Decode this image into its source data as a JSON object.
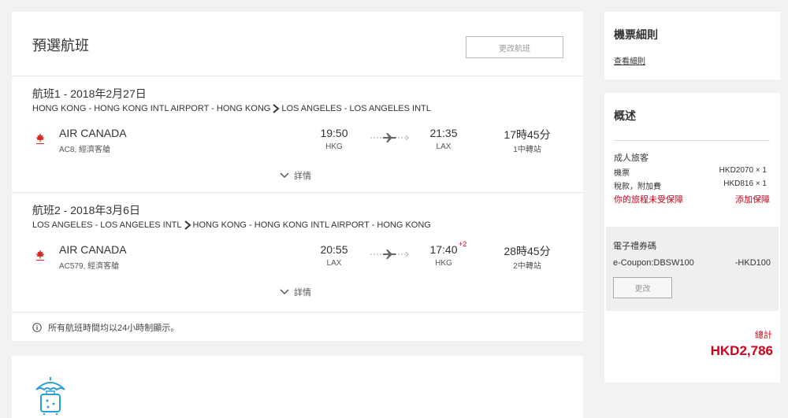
{
  "header": {
    "title": "預選航班",
    "change_button": "更改航班"
  },
  "segments": [
    {
      "title": "航班1 - 2018年2月27日",
      "origin": "HONG KONG - HONG KONG INTL AIRPORT - HONG KONG",
      "destination": "LOS ANGELES - LOS ANGELES INTL",
      "airline": "AIR CANADA",
      "flight": "AC8, 經濟客艙",
      "dep_time": "19:50",
      "dep_code": "HKG",
      "arr_time": "21:35",
      "arr_code": "LAX",
      "plus_day": "",
      "duration": "17時45分",
      "stops": "1中轉站",
      "details_label": "詳情"
    },
    {
      "title": "航班2 - 2018年3月6日",
      "origin": "LOS ANGELES - LOS ANGELES INTL",
      "destination": "HONG KONG - HONG KONG INTL AIRPORT - HONG KONG",
      "airline": "AIR CANADA",
      "flight": "AC579, 經濟客艙",
      "dep_time": "20:55",
      "dep_code": "LAX",
      "arr_time": "17:40",
      "arr_code": "HKG",
      "plus_day": "+2",
      "duration": "28時45分",
      "stops": "2中轉站",
      "details_label": "詳情"
    }
  ],
  "note": "所有航班時間均以24小時制顯示。",
  "rules": {
    "title": "機票細則",
    "link": "查看細則"
  },
  "summary": {
    "title": "概述",
    "pax_title": "成人旅客",
    "rows": [
      {
        "label": "機票",
        "value": "HKD2070 × 1"
      },
      {
        "label": "稅款，附加費",
        "value": "HKD816 × 1"
      }
    ],
    "warning": "你的旅程未受保障",
    "add_insurance": "添加保障",
    "coupon": {
      "title": "電子禮券碼",
      "code": "e-Coupon:DBSW100",
      "discount": "-HKD100",
      "change_button": "更改"
    },
    "total_label": "總計",
    "total_amount": "HKD2,786"
  },
  "colors": {
    "accent_red": "#d0021b",
    "logo_red": "#d52b1e",
    "icon_blue": "#2a9fd8"
  },
  "icons": [
    "air-canada-logo",
    "route-arrow",
    "plane-arrow",
    "chevron-down",
    "info-circle",
    "insurance-umbrella-luggage"
  ]
}
